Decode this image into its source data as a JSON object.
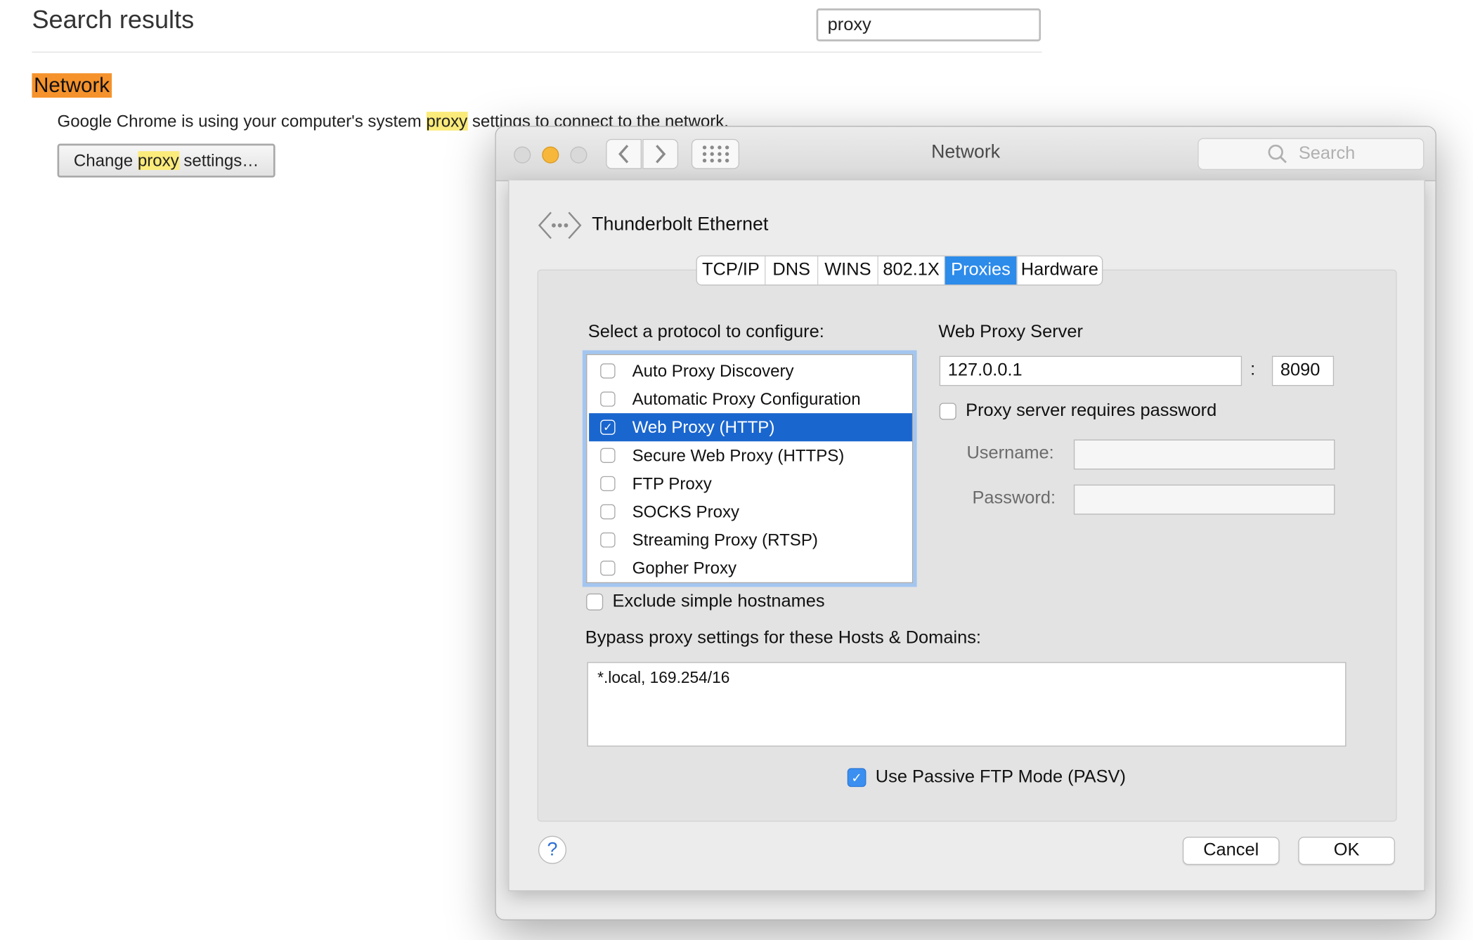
{
  "chrome": {
    "title": "Search results",
    "search_value": "proxy",
    "section_heading": "Network",
    "desc_before": "Google Chrome is using your computer's system ",
    "desc_highlight": "proxy",
    "desc_after": " settings to connect to the network.",
    "btn_before": "Change ",
    "btn_highlight": "proxy",
    "btn_after": " settings…",
    "highlight_color": "#fbeb7a",
    "heading_color": "#f5922b"
  },
  "window": {
    "title": "Network",
    "search_placeholder": "Search",
    "icons": [
      "chevron-left-icon",
      "chevron-right-icon",
      "grid-icon",
      "magnifier-icon"
    ]
  },
  "sheet": {
    "interface_name": "Thunderbolt Ethernet",
    "tabs": [
      {
        "label": "TCP/IP",
        "active": false
      },
      {
        "label": "DNS",
        "active": false
      },
      {
        "label": "WINS",
        "active": false
      },
      {
        "label": "802.1X",
        "active": false
      },
      {
        "label": "Proxies",
        "active": true
      },
      {
        "label": "Hardware",
        "active": false
      }
    ],
    "protocol_label": "Select a protocol to configure:",
    "protocols": [
      {
        "label": "Auto Proxy Discovery",
        "checked": false,
        "selected": false
      },
      {
        "label": "Automatic Proxy Configuration",
        "checked": false,
        "selected": false
      },
      {
        "label": "Web Proxy (HTTP)",
        "checked": true,
        "selected": true
      },
      {
        "label": "Secure Web Proxy (HTTPS)",
        "checked": false,
        "selected": false
      },
      {
        "label": "FTP Proxy",
        "checked": false,
        "selected": false
      },
      {
        "label": "SOCKS Proxy",
        "checked": false,
        "selected": false
      },
      {
        "label": "Streaming Proxy (RTSP)",
        "checked": false,
        "selected": false
      },
      {
        "label": "Gopher Proxy",
        "checked": false,
        "selected": false
      }
    ],
    "server_label": "Web Proxy Server",
    "server_address": "127.0.0.1",
    "port_separator": ":",
    "server_port": "8090",
    "requires_password_label": "Proxy server requires password",
    "requires_password": false,
    "username_label": "Username:",
    "username_value": "",
    "password_label": "Password:",
    "password_value": "",
    "exclude_label": "Exclude simple hostnames",
    "exclude_checked": false,
    "bypass_label": "Bypass proxy settings for these Hosts & Domains:",
    "bypass_value": "*.local, 169.254/16",
    "pasv_label": "Use Passive FTP Mode (PASV)",
    "pasv_checked": true,
    "help_label": "?",
    "cancel_label": "Cancel",
    "ok_label": "OK",
    "accent_color": "#1a66cf"
  }
}
